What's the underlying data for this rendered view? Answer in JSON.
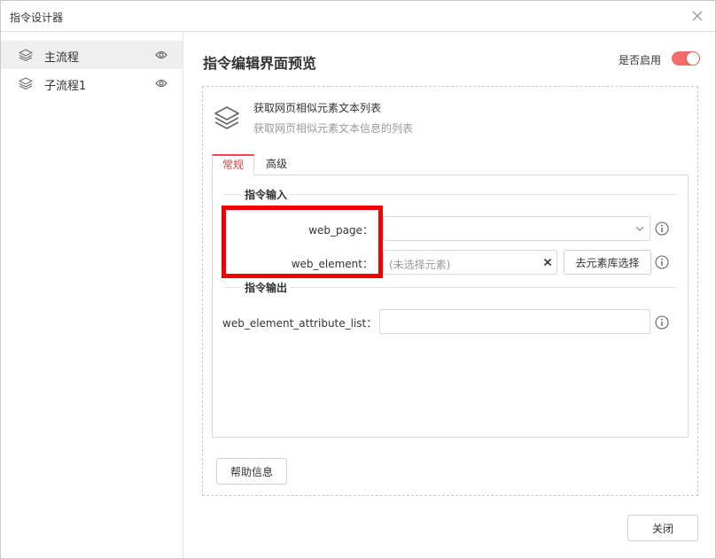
{
  "window": {
    "title": "指令设计器"
  },
  "sidebar": {
    "items": [
      {
        "label": "主流程",
        "active": true
      },
      {
        "label": "子流程1",
        "active": false
      }
    ]
  },
  "main": {
    "title": "指令编辑界面预览",
    "enable_label": "是否启用",
    "enabled": true
  },
  "command": {
    "name": "获取网页相似元素文本列表",
    "description": "获取网页相似元素文本信息的列表"
  },
  "tabs": [
    {
      "label": "常规",
      "active": true
    },
    {
      "label": "高级",
      "active": false
    }
  ],
  "inputs": {
    "section_title": "指令输入",
    "web_page_label": "web_page：",
    "web_page_value": "",
    "web_element_label": "web_element：",
    "web_element_placeholder": "(未选择元素)",
    "pick_button": "去元素库选择"
  },
  "outputs": {
    "section_title": "指令输出",
    "list_label": "web_element_attribute_list：",
    "list_value": ""
  },
  "footer": {
    "help_button": "帮助信息",
    "close_button": "关闭"
  },
  "colors": {
    "accent": "#e94b4b",
    "toggle_on": "#f56b6b",
    "highlight": "#ee0000",
    "sidebar_active_bg": "#efefef"
  }
}
